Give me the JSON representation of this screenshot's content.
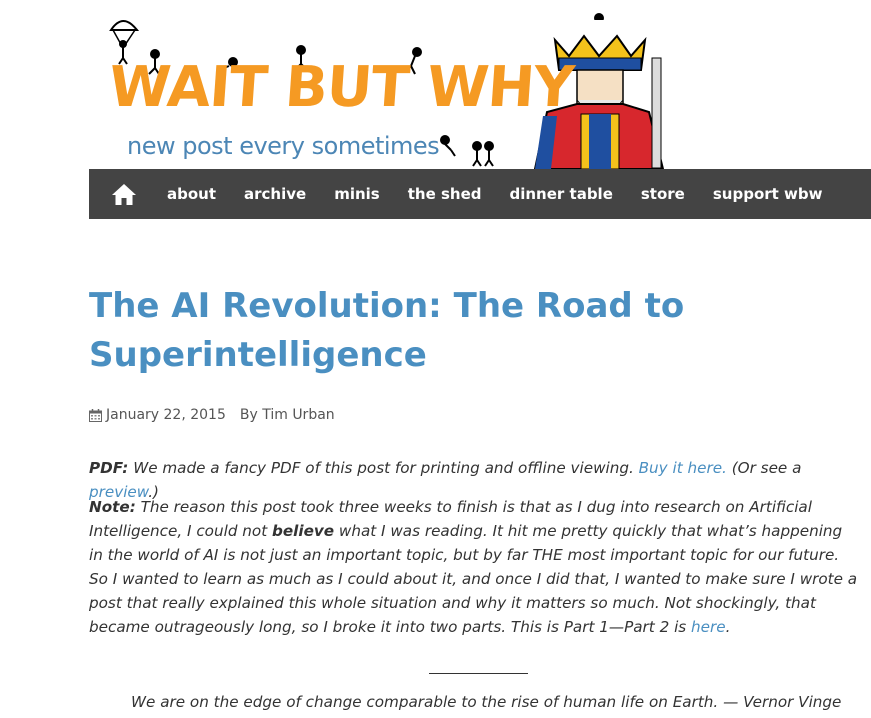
{
  "header": {
    "logo_text": "WAIT BUT WHY",
    "tagline": "new post every sometimes",
    "logo_color": "#f59a23",
    "tagline_color": "#4c86b5"
  },
  "nav": {
    "home_icon": "home-icon",
    "items": [
      {
        "label": "about"
      },
      {
        "label": "archive"
      },
      {
        "label": "minis"
      },
      {
        "label": "the shed"
      },
      {
        "label": "dinner table"
      },
      {
        "label": "store"
      },
      {
        "label": "support wbw"
      }
    ],
    "background": "#444444"
  },
  "article": {
    "title": "The AI Revolution: The Road to Superintelligence",
    "title_color": "#4a8fc1",
    "date": "January 22, 2015",
    "author": "By Tim Urban",
    "pdf_label": "PDF:",
    "pdf_text": "We made a fancy PDF of this post for printing and offline viewing.",
    "pdf_link": "Buy it here.",
    "pdf_text2": "(Or see a",
    "preview_link": "preview",
    "pdf_text3": ".)",
    "note_label": "Note:",
    "note_text1": "The reason this post took three weeks to finish is that as I dug into research on Artificial Intelligence, I could not",
    "note_bold": "believe",
    "note_text2": "what I was reading. It hit me pretty quickly that what’s happening in the world of AI is not just an important topic, but by far THE most important topic for our future. So I wanted to learn as much as I could about it, and once I did that, I wanted to make sure I wrote a post that really explained this whole situation and why it matters so much. Not shockingly, that became outrageously long, so I broke it into two parts. This is Part 1—Part 2 is",
    "note_link": "here",
    "note_end": ".",
    "quote": "We are on the edge of change comparable to the rise of human life on Earth. — Vernor Vinge"
  }
}
